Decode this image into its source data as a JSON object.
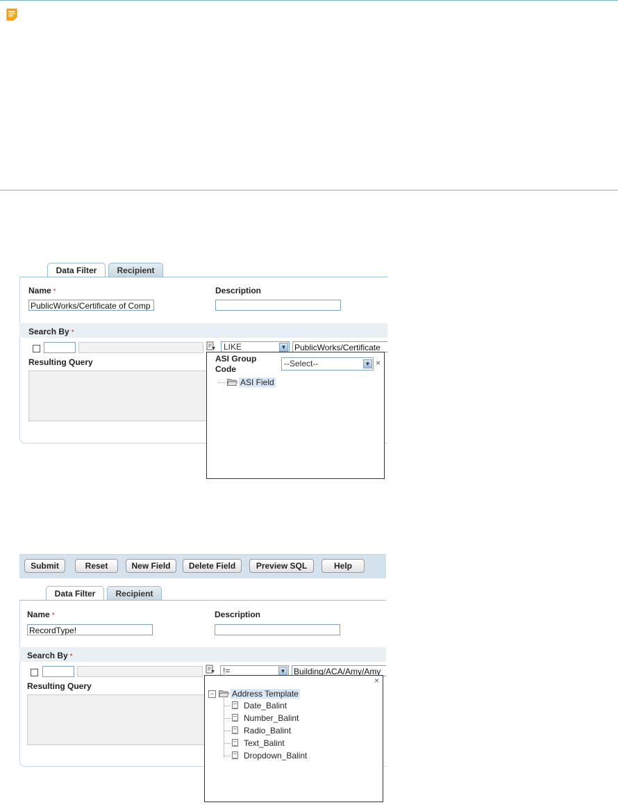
{
  "note": {
    "icon": "note-icon",
    "color": "#f5a623"
  },
  "screen1": {
    "tabs": [
      "Data Filter",
      "Recipient"
    ],
    "name_label": "Name",
    "required_mark": "*",
    "name_value": "PublicWorks/Certificate of Comp",
    "description_label": "Description",
    "description_value": "",
    "search_by_label": "Search By",
    "operator_value": "LIKE",
    "search_value": "PublicWorks/Certificate",
    "resulting_query_label": "Resulting Query",
    "popup": {
      "asi_group_label_line1": "ASI Group",
      "asi_group_label_line2": "Code",
      "select_value": "--Select--",
      "close": "×",
      "tree": [
        "ASI Field"
      ]
    }
  },
  "screen2": {
    "toolbar": [
      "Submit",
      "Reset",
      "New Field",
      "Delete Field",
      "Preview SQL",
      "Help"
    ],
    "tabs": [
      "Data Filter",
      "Recipient"
    ],
    "name_label": "Name",
    "required_mark": "*",
    "name_value": "RecordType!",
    "description_label": "Description",
    "description_value": "",
    "search_by_label": "Search By",
    "operator_value": "!=",
    "search_value": "Building/ACA/Amy/Amy",
    "resulting_query_label": "Resulting Query",
    "popup": {
      "close": "×",
      "expand": "−",
      "root": "Address Template",
      "children": [
        "Date_Balint",
        "Number_Balint",
        "Radio_Balint",
        "Text_Balint",
        "Dropdown_Balint"
      ]
    }
  }
}
